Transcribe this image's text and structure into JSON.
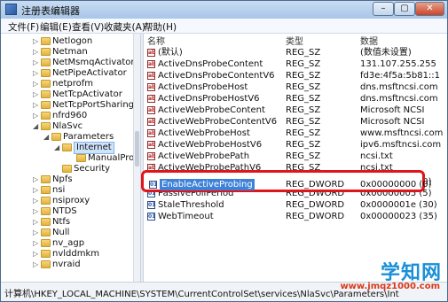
{
  "window": {
    "title": "注册表编辑器",
    "min": "–",
    "max": "▢",
    "close": "✕"
  },
  "menu": [
    "文件(F)",
    "编辑(E)",
    "查看(V)",
    "收藏夹(A)",
    "帮助(H)"
  ],
  "tree": [
    {
      "label": "Netlogon",
      "arrow": "▷"
    },
    {
      "label": "Netman",
      "arrow": "▷"
    },
    {
      "label": "NetMsmqActivator",
      "arrow": "▷"
    },
    {
      "label": "NetPipeActivator",
      "arrow": "▷"
    },
    {
      "label": "netprofm",
      "arrow": "▷"
    },
    {
      "label": "NetTcpActivator",
      "arrow": "▷"
    },
    {
      "label": "NetTcpPortSharing",
      "arrow": "▷"
    },
    {
      "label": "nfrd960",
      "arrow": "▷"
    },
    {
      "label": "NlaSvc",
      "arrow": "◢"
    },
    {
      "label": "Parameters",
      "arrow": "◢"
    },
    {
      "label": "Internet",
      "arrow": "◢"
    },
    {
      "label": "ManualProxies",
      "arrow": ""
    },
    {
      "label": "Security",
      "arrow": ""
    },
    {
      "label": "Npfs",
      "arrow": "▷"
    },
    {
      "label": "nsi",
      "arrow": "▷"
    },
    {
      "label": "nsiproxy",
      "arrow": "▷"
    },
    {
      "label": "NTDS",
      "arrow": "▷"
    },
    {
      "label": "Ntfs",
      "arrow": "▷"
    },
    {
      "label": "Null",
      "arrow": "▷"
    },
    {
      "label": "nv_agp",
      "arrow": "▷"
    },
    {
      "label": "nvlddmkm",
      "arrow": "▷"
    },
    {
      "label": "nvraid",
      "arrow": "▷"
    }
  ],
  "columns": {
    "name": "名称",
    "type": "类型",
    "data": "数据"
  },
  "values": [
    {
      "name": "(默认)",
      "type": "REG_SZ",
      "data": "(数值未设置)",
      "icon": "ab"
    },
    {
      "name": "ActiveDnsProbeContent",
      "type": "REG_SZ",
      "data": "131.107.255.255",
      "icon": "ab"
    },
    {
      "name": "ActiveDnsProbeContentV6",
      "type": "REG_SZ",
      "data": "fd3e:4f5a:5b81::1",
      "icon": "ab"
    },
    {
      "name": "ActiveDnsProbeHost",
      "type": "REG_SZ",
      "data": "dns.msftncsi.com",
      "icon": "ab"
    },
    {
      "name": "ActiveDnsProbeHostV6",
      "type": "REG_SZ",
      "data": "dns.msftncsi.com",
      "icon": "ab"
    },
    {
      "name": "ActiveWebProbeContent",
      "type": "REG_SZ",
      "data": "Microsoft NCSI",
      "icon": "ab"
    },
    {
      "name": "ActiveWebProbeContentV6",
      "type": "REG_SZ",
      "data": "Microsoft NCSI",
      "icon": "ab"
    },
    {
      "name": "ActiveWebProbeHost",
      "type": "REG_SZ",
      "data": "www.msftncsi.com",
      "icon": "ab"
    },
    {
      "name": "ActiveWebProbeHostV6",
      "type": "REG_SZ",
      "data": "ipv6.msftncsi.com",
      "icon": "ab"
    },
    {
      "name": "ActiveWebProbePath",
      "type": "REG_SZ",
      "data": "ncsi.txt",
      "icon": "ab"
    },
    {
      "name": "ActiveWebProbePathV6",
      "type": "REG_SZ",
      "data": "ncsi.txt",
      "icon": "ab"
    },
    {
      "name": "EnableActiveProbing",
      "type": "REG_DWORD",
      "data": "0x00000000 (0)",
      "icon": "dw"
    },
    {
      "name": "PassivePollPeriod",
      "type": "REG_DWORD",
      "data": "0x00000005 (5)",
      "icon": "dw"
    },
    {
      "name": "StaleThreshold",
      "type": "REG_DWORD",
      "data": "0x0000001e (30)",
      "icon": "dw"
    },
    {
      "name": "WebTimeout",
      "type": "REG_DWORD",
      "data": "0x00000023 (35)",
      "icon": "dw"
    }
  ],
  "status": "计算机\\HKEY_LOCAL_MACHINE\\SYSTEM\\CurrentControlSet\\services\\NlaSvc\\Parameters\\Int",
  "watermark": {
    "logo": "学知网",
    "url": "www.jmqz1000.com"
  },
  "colors": {
    "highlight": "#e0151b",
    "selection": "#3e82d8"
  }
}
